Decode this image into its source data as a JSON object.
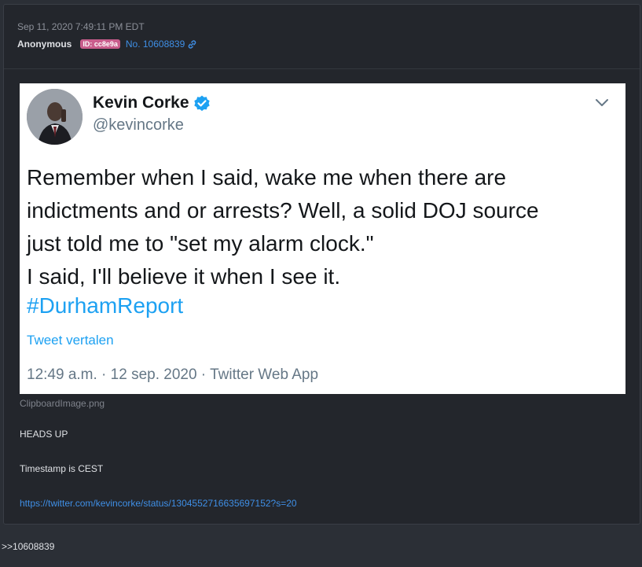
{
  "post": {
    "date": "Sep 11, 2020 7:49:11 PM EDT",
    "author": "Anonymous",
    "id_badge": "ID: cc8e9a",
    "post_number": "No. 10608839",
    "id_badge_color": "#c95d8c",
    "link_color": "#3f8fe6"
  },
  "embed": {
    "filename": "ClipboardImage.png",
    "tweet": {
      "display_name": "Kevin Corke",
      "handle": "@kevincorke",
      "verified_icon": "verified-badge-icon",
      "text_lines": [
        "Remember when I said, wake me when there are",
        "indictments and or arrests?  Well, a solid DOJ source",
        "just told me to \"set my alarm clock.\"",
        "I said, I'll believe it when I see it."
      ],
      "hashtag": "#DurhamReport",
      "translate_label": "Tweet vertalen",
      "meta": "12:49 a.m. · 12 sep. 2020 · Twitter Web App"
    }
  },
  "body": {
    "line1": "HEADS UP",
    "line2": "Timestamp is CEST",
    "link": "https://twitter.com/kevincorke/status/1304552716635697152?s=20"
  },
  "reply": {
    "ref": ">>10608839"
  }
}
